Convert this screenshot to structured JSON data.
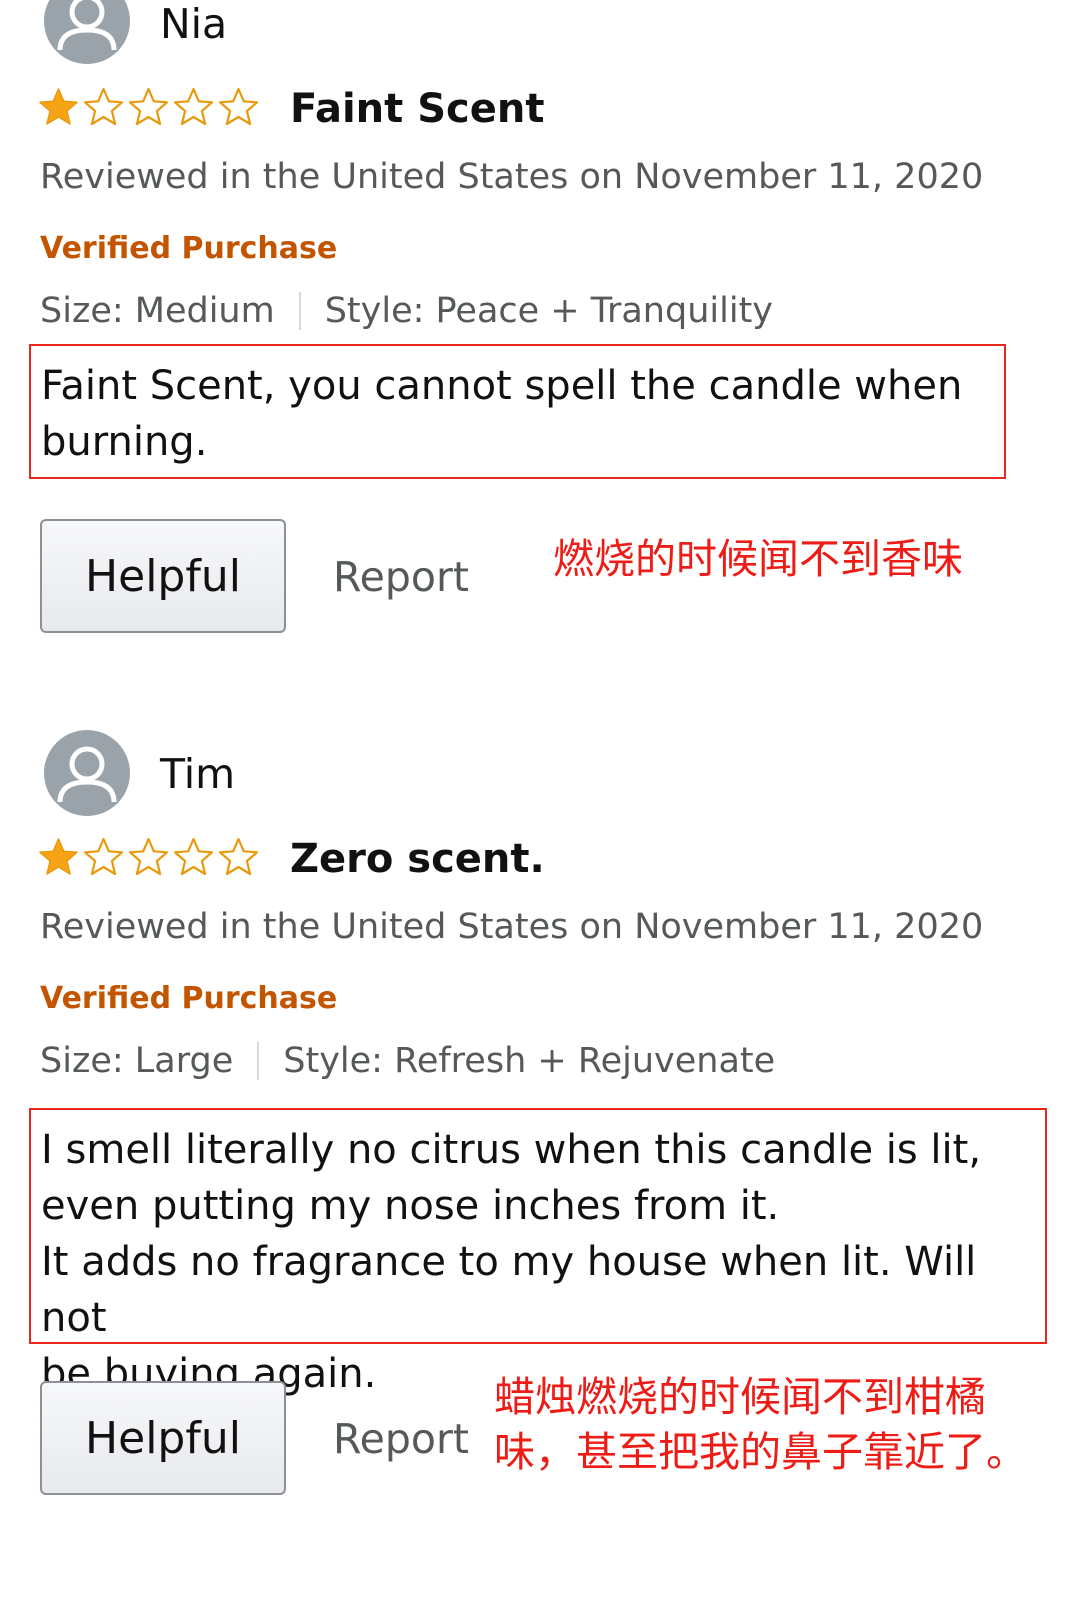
{
  "reviews": [
    {
      "reviewer": "Nia",
      "rating": 1,
      "max_rating": 5,
      "title": "Faint Scent",
      "date_line": "Reviewed in the United States on November 11, 2020",
      "verified": "Verified Purchase",
      "size": "Size: Medium",
      "style": "Style: Peace + Tranquility",
      "body_lines": [
        "Faint Scent, you cannot spell the candle when",
        "burning."
      ],
      "helpful_label": "Helpful",
      "report_label": "Report",
      "annotation_lines": [
        "燃烧的时候闻不到香味"
      ]
    },
    {
      "reviewer": "Tim",
      "rating": 1,
      "max_rating": 5,
      "title": "Zero scent.",
      "date_line": "Reviewed in the United States on November 11, 2020",
      "verified": "Verified Purchase",
      "size": "Size: Large",
      "style": "Style: Refresh + Rejuvenate",
      "body_lines": [
        "I smell literally no citrus when this candle is lit,",
        "even putting my nose inches from it.",
        "It adds no fragrance to my house when lit. Will not",
        "be buying again."
      ],
      "helpful_label": "Helpful",
      "report_label": "Report",
      "annotation_lines": [
        "蜡烛燃烧的时候闻不到柑橘",
        "味，甚至把我的鼻子靠近了。"
      ]
    }
  ],
  "colors": {
    "star_filled": "#f6a415",
    "star_empty_stroke": "#e99a0c",
    "verified": "#c45500",
    "highlight_box": "#e8281e",
    "annotation_text": "#ee1c16"
  },
  "icons": {
    "avatar": "default-user-avatar-icon",
    "star": "star-icon"
  }
}
